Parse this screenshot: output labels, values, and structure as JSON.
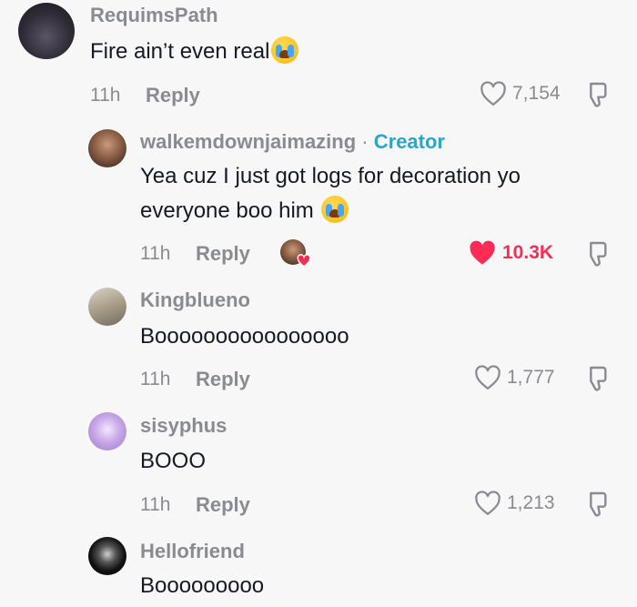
{
  "comments": [
    {
      "username": "RequimsPath",
      "text_lines": [
        "Fire ain’t even real"
      ],
      "emoji": "crying-face",
      "time": "11h",
      "reply_label": "Reply",
      "likes": "7,154",
      "liked": false
    },
    {
      "username": "walkemdownjaimazing",
      "separator": "·",
      "badge": "Creator",
      "text_lines": [
        "Yea cuz I just got logs for decoration yo",
        "everyone boo him"
      ],
      "emoji": "crying-face",
      "time": "11h",
      "reply_label": "Reply",
      "likes": "10.3K",
      "liked": true,
      "liked_by_creator": true
    },
    {
      "username": "Kingblueno",
      "text_lines": [
        "Boooooooooooooooo"
      ],
      "time": "11h",
      "reply_label": "Reply",
      "likes": "1,777",
      "liked": false
    },
    {
      "username": "sisyphus",
      "text_lines": [
        "BOOO"
      ],
      "time": "11h",
      "reply_label": "Reply",
      "likes": "1,213",
      "liked": false
    },
    {
      "username": "Hellofriend",
      "text_lines": [
        "Booooooooo"
      ]
    }
  ],
  "colors": {
    "muted": "#8a8b91",
    "text": "#161823",
    "creator": "#2aa7c8",
    "liked": "#fe2c55",
    "background": "#f7f7f7"
  },
  "icons": {
    "like": "heart-outline-icon",
    "liked": "heart-filled-icon",
    "dislike": "thumbs-down-icon",
    "creator_like": "creator-liked-avatar-icon"
  }
}
